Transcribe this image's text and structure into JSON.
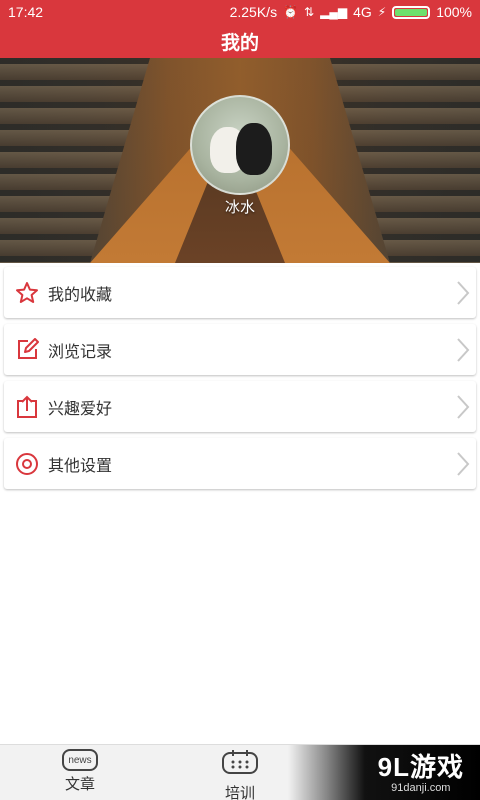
{
  "status_bar": {
    "time": "17:42",
    "speed": "2.25K/s",
    "network": "4G",
    "battery": "100%",
    "battery_level": 1.0
  },
  "header": {
    "title": "我的"
  },
  "profile": {
    "username": "冰水"
  },
  "menu": {
    "items": [
      {
        "label": "我的收藏",
        "icon": "star-icon"
      },
      {
        "label": "浏览记录",
        "icon": "edit-icon"
      },
      {
        "label": "兴趣爱好",
        "icon": "share-icon"
      },
      {
        "label": "其他设置",
        "icon": "target-icon"
      }
    ]
  },
  "tabs": [
    {
      "label": "文章",
      "icon": "news-icon",
      "icon_text": "news"
    },
    {
      "label": "培训",
      "icon": "calendar-icon"
    }
  ],
  "watermark": {
    "main": "9L游戏",
    "sub": "91danji.com"
  },
  "colors": {
    "accent": "#d9373d",
    "icon": "#d9373d"
  }
}
